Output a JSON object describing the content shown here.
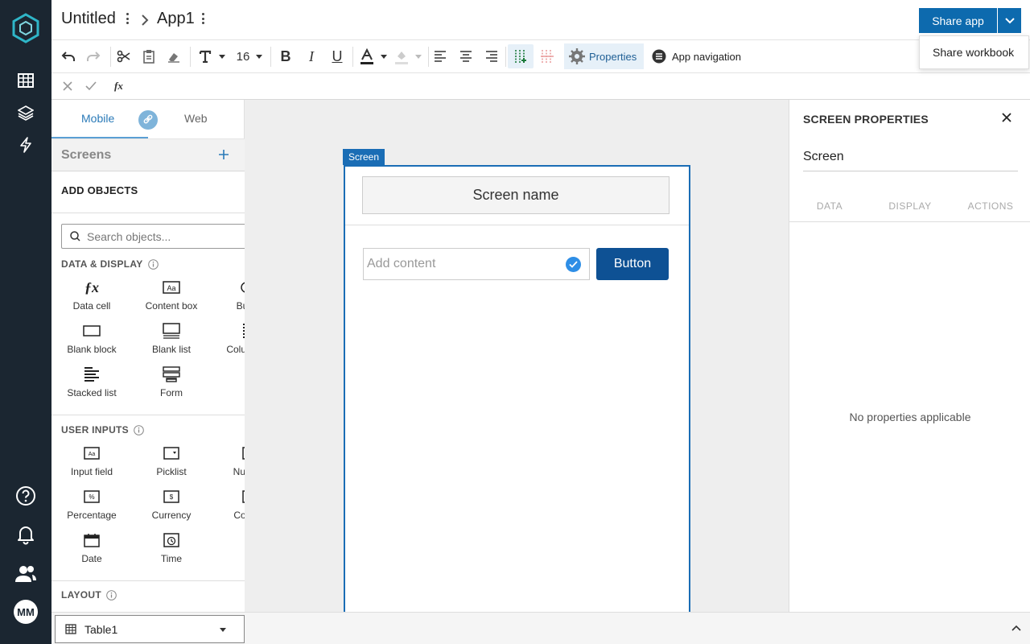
{
  "brand": {
    "accent": "#0d6aae",
    "rail_bg": "#1b2631"
  },
  "user": {
    "initials": "MM"
  },
  "header": {
    "workbook_title": "Untitled",
    "app_title": "App1",
    "share_label": "Share app",
    "dropdown_item": "Share workbook"
  },
  "toolbar": {
    "font_size": "16",
    "properties_label": "Properties",
    "app_navigation_label": "App navigation"
  },
  "formula_bar": {
    "fx": "fx"
  },
  "left_panel": {
    "tabs": {
      "mobile": "Mobile",
      "web": "Web"
    },
    "screens_label": "Screens",
    "add_objects_title": "ADD OBJECTS",
    "search_placeholder": "Search objects...",
    "sections": {
      "data_display": "DATA & DISPLAY",
      "user_inputs": "USER INPUTS",
      "layout": "LAYOUT"
    },
    "data_display_items": [
      "Data cell",
      "Content box",
      "Button",
      "Blank block",
      "Blank list",
      "Column list",
      "Stacked list",
      "Form"
    ],
    "user_input_items": [
      "Input field",
      "Picklist",
      "Number",
      "Percentage",
      "Currency",
      "Contact",
      "Date",
      "Time"
    ]
  },
  "canvas": {
    "frame_tag": "Screen",
    "screen_name": "Screen name",
    "add_content_placeholder": "Add content",
    "button_label": "Button"
  },
  "right_panel": {
    "title": "SCREEN PROPERTIES",
    "name_value": "Screen",
    "tabs": [
      "DATA",
      "DISPLAY",
      "ACTIONS"
    ],
    "empty_text": "No properties applicable"
  },
  "bottom_bar": {
    "sheet_name": "Table1"
  }
}
